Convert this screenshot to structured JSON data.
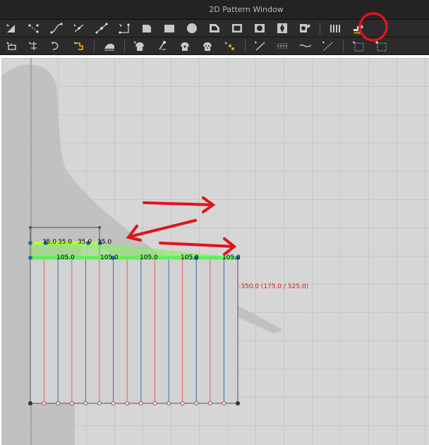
{
  "window": {
    "title": "2D Pattern Window"
  },
  "toolbar_top": {
    "tools": [
      "select-icon",
      "edit-point-icon",
      "edit-curve-icon",
      "curve-point-icon",
      "add-point-icon",
      "polygon-icon",
      "rectangle-icon",
      "filled-rectangle-icon",
      "circle-icon",
      "internal-polygon-icon",
      "internal-rectangle-icon",
      "internal-circle-icon",
      "dart-icon",
      "gather-icon",
      "pleat-icon",
      "fold-arrangement-icon"
    ]
  },
  "toolbar_bottom": {
    "tools": [
      "sewing-select-icon",
      "segment-sewing-icon",
      "free-sewing-icon",
      "fold-sewing-icon",
      "iron-icon",
      "garment-select-icon",
      "pin-icon",
      "tack-icon",
      "tack-on-avatar-icon",
      "button-icon",
      "line-tool-icon",
      "dotted-line-icon",
      "wave-line-icon",
      "topstitch-icon",
      "texture-select-icon",
      "texture-edit-icon"
    ]
  },
  "pattern": {
    "measure_labels": [
      "105.0",
      "105.0",
      "105.0",
      "105.0",
      "105.0"
    ],
    "pleat_labels": [
      "35.0",
      "35.0",
      "35.0",
      "35.0"
    ],
    "dimension_text": "-350.0 (175.0 / 525.0)"
  },
  "annotations": {
    "highlight_color": "#e0141e",
    "arrow_color": "#e0141e"
  }
}
